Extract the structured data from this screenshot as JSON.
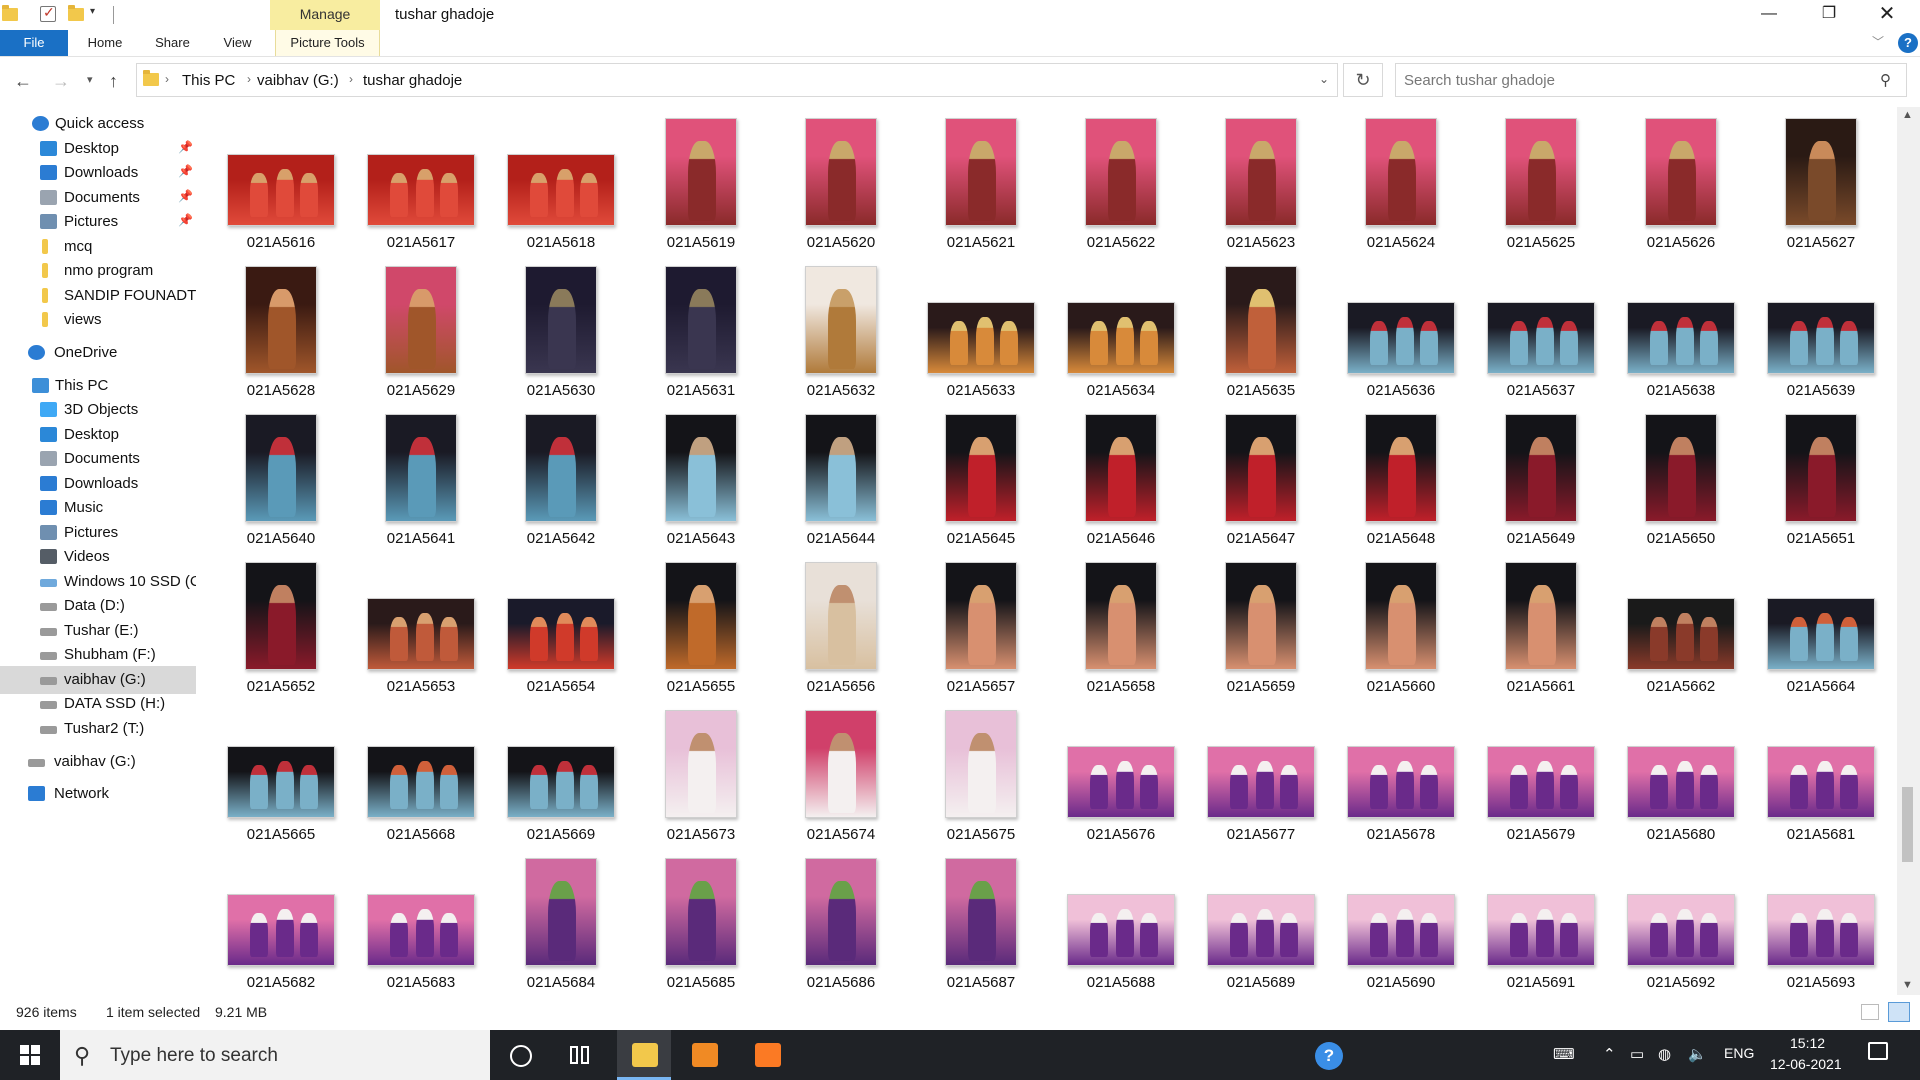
{
  "window": {
    "title": "tushar ghadoje",
    "context_tab": "Manage",
    "minimize_glyph": "—",
    "maximize_glyph": "❐",
    "close_glyph": "✕"
  },
  "ribbon": {
    "tabs": [
      "File",
      "Home",
      "Share",
      "View",
      "Picture Tools"
    ],
    "help_glyph": "?"
  },
  "address": {
    "crumbs": [
      "This PC",
      "vaibhav  (G:)",
      "tushar ghadoje"
    ],
    "search_placeholder": "Search tushar ghadoje"
  },
  "sidebar": {
    "items": [
      {
        "label": "Quick access",
        "icon": "star-icon",
        "color": "#2b7cd3",
        "pinned": false
      },
      {
        "label": "Desktop",
        "icon": "desktop-icon",
        "color": "#2b88d8",
        "pinned": true
      },
      {
        "label": "Downloads",
        "icon": "download-icon",
        "color": "#2b7cd3",
        "pinned": true
      },
      {
        "label": "Documents",
        "icon": "documents-icon",
        "color": "#9aa4b0",
        "pinned": true
      },
      {
        "label": "Pictures",
        "icon": "pictures-icon",
        "color": "#6f8fb0",
        "pinned": true
      },
      {
        "label": "mcq",
        "icon": "folder-icon",
        "color": "#f2c84b",
        "pinned": false
      },
      {
        "label": "nmo program",
        "icon": "folder-icon",
        "color": "#f2c84b",
        "pinned": false
      },
      {
        "label": "SANDIP FOUNADTI(",
        "icon": "folder-icon",
        "color": "#f2c84b",
        "pinned": false
      },
      {
        "label": "views",
        "icon": "folder-icon",
        "color": "#f2c84b",
        "pinned": false
      },
      {
        "label": "OneDrive",
        "icon": "cloud-icon",
        "color": "#2b7cd3",
        "pinned": false
      },
      {
        "label": "This PC",
        "icon": "computer-icon",
        "color": "#3d8fd8",
        "pinned": false
      },
      {
        "label": "3D Objects",
        "icon": "cube-icon",
        "color": "#3fa9f5",
        "pinned": false
      },
      {
        "label": "Desktop",
        "icon": "desktop-icon",
        "color": "#2b88d8",
        "pinned": false
      },
      {
        "label": "Documents",
        "icon": "documents-icon",
        "color": "#9aa4b0",
        "pinned": false
      },
      {
        "label": "Downloads",
        "icon": "download-icon",
        "color": "#2b7cd3",
        "pinned": false
      },
      {
        "label": "Music",
        "icon": "music-icon",
        "color": "#2b7cd3",
        "pinned": false
      },
      {
        "label": "Pictures",
        "icon": "pictures-icon",
        "color": "#6f8fb0",
        "pinned": false
      },
      {
        "label": "Videos",
        "icon": "videos-icon",
        "color": "#555d66",
        "pinned": false
      },
      {
        "label": "Windows 10 SSD (C",
        "icon": "drive-icon",
        "color": "#6fa9dc",
        "pinned": false
      },
      {
        "label": "Data (D:)",
        "icon": "drive-icon",
        "color": "#9a9a9a",
        "pinned": false
      },
      {
        "label": "Tushar (E:)",
        "icon": "drive-icon",
        "color": "#9a9a9a",
        "pinned": false
      },
      {
        "label": "Shubham (F:)",
        "icon": "drive-icon",
        "color": "#9a9a9a",
        "pinned": false
      },
      {
        "label": "vaibhav  (G:)",
        "icon": "drive-icon",
        "color": "#9a9a9a",
        "pinned": false
      },
      {
        "label": "DATA SSD (H:)",
        "icon": "drive-icon",
        "color": "#9a9a9a",
        "pinned": false
      },
      {
        "label": "Tushar2 (T:)",
        "icon": "drive-icon",
        "color": "#9a9a9a",
        "pinned": false
      },
      {
        "label": "vaibhav  (G:)",
        "icon": "drive-icon",
        "color": "#9a9a9a",
        "pinned": false
      },
      {
        "label": "Network",
        "icon": "network-icon",
        "color": "#2b7cd3",
        "pinned": false
      }
    ],
    "selected_label": "vaibhav  (G:)"
  },
  "files": [
    {
      "name": "021A5616",
      "orient": "landscape",
      "colors": [
        "#b3201a",
        "#e04a3a",
        "#d8a06a"
      ]
    },
    {
      "name": "021A5617",
      "orient": "landscape",
      "colors": [
        "#b3201a",
        "#e04a3a",
        "#d8a06a"
      ]
    },
    {
      "name": "021A5618",
      "orient": "landscape",
      "colors": [
        "#b3201a",
        "#e04a3a",
        "#d8a06a"
      ]
    },
    {
      "name": "021A5619",
      "orient": "portrait",
      "colors": [
        "#e0527a",
        "#8a2a2a",
        "#c9a86a"
      ]
    },
    {
      "name": "021A5620",
      "orient": "portrait",
      "colors": [
        "#e0527a",
        "#8a2a2a",
        "#c9a86a"
      ]
    },
    {
      "name": "021A5621",
      "orient": "portrait",
      "colors": [
        "#e0527a",
        "#8a2a2a",
        "#c9a86a"
      ]
    },
    {
      "name": "021A5622",
      "orient": "portrait",
      "colors": [
        "#e0527a",
        "#8a2a2a",
        "#c9a86a"
      ]
    },
    {
      "name": "021A5623",
      "orient": "portrait",
      "colors": [
        "#e0527a",
        "#8a2a2a",
        "#c9a86a"
      ]
    },
    {
      "name": "021A5624",
      "orient": "portrait",
      "colors": [
        "#e0527a",
        "#8a2a2a",
        "#c9a86a"
      ]
    },
    {
      "name": "021A5625",
      "orient": "portrait",
      "colors": [
        "#e0527a",
        "#8a2a2a",
        "#c9a86a"
      ]
    },
    {
      "name": "021A5626",
      "orient": "portrait",
      "colors": [
        "#e0527a",
        "#8a2a2a",
        "#c9a86a"
      ]
    },
    {
      "name": "021A5627",
      "orient": "portrait",
      "colors": [
        "#2a1a14",
        "#7a4a2a",
        "#c98a5a"
      ]
    },
    {
      "name": "021A5628",
      "orient": "portrait",
      "colors": [
        "#3a1a12",
        "#a0562a",
        "#d89a6a"
      ]
    },
    {
      "name": "021A5629",
      "orient": "portrait",
      "colors": [
        "#d0486a",
        "#a0562a",
        "#d89a6a"
      ]
    },
    {
      "name": "021A5630",
      "orient": "portrait",
      "colors": [
        "#1e1a30",
        "#3a3650",
        "#8a7a5a"
      ]
    },
    {
      "name": "021A5631",
      "orient": "portrait",
      "colors": [
        "#1e1a30",
        "#3a3650",
        "#8a7a5a"
      ]
    },
    {
      "name": "021A5632",
      "orient": "portrait",
      "colors": [
        "#f0e8e0",
        "#b07a3a",
        "#c9a06a"
      ]
    },
    {
      "name": "021A5633",
      "orient": "landscape",
      "colors": [
        "#2a1a1a",
        "#d88a3a",
        "#e0c070"
      ]
    },
    {
      "name": "021A5634",
      "orient": "landscape",
      "colors": [
        "#2a1a1a",
        "#d88a3a",
        "#e0c070"
      ]
    },
    {
      "name": "021A5635",
      "orient": "portrait",
      "colors": [
        "#2a1a1a",
        "#c0603a",
        "#e0c070"
      ]
    },
    {
      "name": "021A5636",
      "orient": "landscape",
      "colors": [
        "#1a1a24",
        "#7ab0c8",
        "#c0303a"
      ]
    },
    {
      "name": "021A5637",
      "orient": "landscape",
      "colors": [
        "#1a1a24",
        "#7ab0c8",
        "#c0303a"
      ]
    },
    {
      "name": "021A5638",
      "orient": "landscape",
      "colors": [
        "#1a1a24",
        "#7ab0c8",
        "#c0303a"
      ]
    },
    {
      "name": "021A5639",
      "orient": "landscape",
      "colors": [
        "#1a1a24",
        "#7ab0c8",
        "#c0303a"
      ]
    },
    {
      "name": "021A5640",
      "orient": "portrait",
      "colors": [
        "#1a1a24",
        "#5a9ab8",
        "#c0303a"
      ]
    },
    {
      "name": "021A5641",
      "orient": "portrait",
      "colors": [
        "#1a1a24",
        "#5a9ab8",
        "#c0303a"
      ]
    },
    {
      "name": "021A5642",
      "orient": "portrait",
      "colors": [
        "#1a1a24",
        "#5a9ab8",
        "#c0303a"
      ]
    },
    {
      "name": "021A5643",
      "orient": "portrait",
      "colors": [
        "#141418",
        "#8ac0d8",
        "#c0a080"
      ]
    },
    {
      "name": "021A5644",
      "orient": "portrait",
      "colors": [
        "#141418",
        "#8ac0d8",
        "#c0a080"
      ]
    },
    {
      "name": "021A5645",
      "orient": "portrait",
      "colors": [
        "#141418",
        "#c0202a",
        "#d8a070"
      ]
    },
    {
      "name": "021A5646",
      "orient": "portrait",
      "colors": [
        "#141418",
        "#c0202a",
        "#d8a070"
      ]
    },
    {
      "name": "021A5647",
      "orient": "portrait",
      "colors": [
        "#141418",
        "#c0202a",
        "#d8a070"
      ]
    },
    {
      "name": "021A5648",
      "orient": "portrait",
      "colors": [
        "#141418",
        "#c0202a",
        "#d8a070"
      ]
    },
    {
      "name": "021A5649",
      "orient": "portrait",
      "colors": [
        "#141418",
        "#8a1a2a",
        "#c08060"
      ]
    },
    {
      "name": "021A5650",
      "orient": "portrait",
      "colors": [
        "#141418",
        "#8a1a2a",
        "#c08060"
      ]
    },
    {
      "name": "021A5651",
      "orient": "portrait",
      "colors": [
        "#141418",
        "#8a1a2a",
        "#c08060"
      ]
    },
    {
      "name": "021A5652",
      "orient": "portrait",
      "colors": [
        "#141418",
        "#8a1a2a",
        "#c08060"
      ]
    },
    {
      "name": "021A5653",
      "orient": "landscape",
      "colors": [
        "#2a1a1a",
        "#c05a3a",
        "#d8a070"
      ]
    },
    {
      "name": "021A5654",
      "orient": "landscape",
      "colors": [
        "#1a1a2a",
        "#d03a2a",
        "#e08a5a"
      ]
    },
    {
      "name": "021A5655",
      "orient": "portrait",
      "colors": [
        "#141418",
        "#c06a2a",
        "#d8a070"
      ]
    },
    {
      "name": "021A5656",
      "orient": "portrait",
      "colors": [
        "#e8e0d8",
        "#d8c0a0",
        "#c09070"
      ]
    },
    {
      "name": "021A5657",
      "orient": "portrait",
      "colors": [
        "#141418",
        "#d89070",
        "#d8a070"
      ]
    },
    {
      "name": "021A5658",
      "orient": "portrait",
      "colors": [
        "#141418",
        "#d89070",
        "#d8a070"
      ]
    },
    {
      "name": "021A5659",
      "orient": "portrait",
      "colors": [
        "#141418",
        "#d89070",
        "#d8a070"
      ]
    },
    {
      "name": "021A5660",
      "orient": "portrait",
      "colors": [
        "#141418",
        "#d89070",
        "#d8a070"
      ]
    },
    {
      "name": "021A5661",
      "orient": "portrait",
      "colors": [
        "#141418",
        "#d89070",
        "#d8a070"
      ]
    },
    {
      "name": "021A5662",
      "orient": "landscape",
      "colors": [
        "#1a1a1a",
        "#8a3a2a",
        "#c08060"
      ]
    },
    {
      "name": "021A5664",
      "orient": "landscape",
      "colors": [
        "#1a1a24",
        "#7ab0c8",
        "#d0603a"
      ]
    },
    {
      "name": "021A5665",
      "orient": "landscape",
      "colors": [
        "#141418",
        "#7ab0c8",
        "#c0303a"
      ]
    },
    {
      "name": "021A5668",
      "orient": "landscape",
      "colors": [
        "#141418",
        "#7ab0c8",
        "#d0603a"
      ]
    },
    {
      "name": "021A5669",
      "orient": "landscape",
      "colors": [
        "#141418",
        "#7ab0c8",
        "#c0303a"
      ]
    },
    {
      "name": "021A5673",
      "orient": "portrait",
      "colors": [
        "#e8c0d8",
        "#f4f0f0",
        "#c09070"
      ]
    },
    {
      "name": "021A5674",
      "orient": "portrait",
      "colors": [
        "#d0406a",
        "#f4f0f0",
        "#c09070"
      ]
    },
    {
      "name": "021A5675",
      "orient": "portrait",
      "colors": [
        "#e8c0d8",
        "#f4f0f0",
        "#c09070"
      ]
    },
    {
      "name": "021A5676",
      "orient": "landscape",
      "colors": [
        "#e070a8",
        "#6a2a8a",
        "#f4f0f0"
      ]
    },
    {
      "name": "021A5677",
      "orient": "landscape",
      "colors": [
        "#e070a8",
        "#6a2a8a",
        "#f4f0f0"
      ]
    },
    {
      "name": "021A5678",
      "orient": "landscape",
      "colors": [
        "#e070a8",
        "#6a2a8a",
        "#f4f0f0"
      ]
    },
    {
      "name": "021A5679",
      "orient": "landscape",
      "colors": [
        "#e070a8",
        "#6a2a8a",
        "#f4f0f0"
      ]
    },
    {
      "name": "021A5680",
      "orient": "landscape",
      "colors": [
        "#e070a8",
        "#6a2a8a",
        "#f4f0f0"
      ]
    },
    {
      "name": "021A5681",
      "orient": "landscape",
      "colors": [
        "#e070a8",
        "#6a2a8a",
        "#f4f0f0"
      ]
    },
    {
      "name": "021A5682",
      "orient": "landscape",
      "colors": [
        "#e070a8",
        "#6a2a8a",
        "#f4f0f0"
      ]
    },
    {
      "name": "021A5683",
      "orient": "landscape",
      "colors": [
        "#e070a8",
        "#6a2a8a",
        "#f4f0f0"
      ]
    },
    {
      "name": "021A5684",
      "orient": "portrait",
      "colors": [
        "#d06aa0",
        "#5a2a7a",
        "#6aa04a"
      ]
    },
    {
      "name": "021A5685",
      "orient": "portrait",
      "colors": [
        "#d06aa0",
        "#5a2a7a",
        "#6aa04a"
      ]
    },
    {
      "name": "021A5686",
      "orient": "portrait",
      "colors": [
        "#d06aa0",
        "#5a2a7a",
        "#6aa04a"
      ]
    },
    {
      "name": "021A5687",
      "orient": "portrait",
      "colors": [
        "#d06aa0",
        "#5a2a7a",
        "#6aa04a"
      ]
    },
    {
      "name": "021A5688",
      "orient": "landscape",
      "colors": [
        "#f0c0d8",
        "#6a2a8a",
        "#f4f0f0"
      ]
    },
    {
      "name": "021A5689",
      "orient": "landscape",
      "colors": [
        "#f0c0d8",
        "#6a2a8a",
        "#f4f0f0"
      ]
    },
    {
      "name": "021A5690",
      "orient": "landscape",
      "colors": [
        "#f0c0d8",
        "#6a2a8a",
        "#f4f0f0"
      ]
    },
    {
      "name": "021A5691",
      "orient": "landscape",
      "colors": [
        "#f0c0d8",
        "#6a2a8a",
        "#f4f0f0"
      ]
    },
    {
      "name": "021A5692",
      "orient": "landscape",
      "colors": [
        "#f0c0d8",
        "#6a2a8a",
        "#f4f0f0"
      ]
    },
    {
      "name": "021A5693",
      "orient": "landscape",
      "colors": [
        "#f0c0d8",
        "#6a2a8a",
        "#f4f0f0"
      ]
    }
  ],
  "status": {
    "count": "926 items",
    "selected": "1 item selected",
    "size": "9.21 MB"
  },
  "taskbar": {
    "search_placeholder": "Type here to search",
    "language": "ENG",
    "time": "15:12",
    "date": "12-06-2021",
    "help_glyph": "?"
  },
  "colors": {
    "accent": "#1a70c5",
    "manage_tab": "#f8eda0",
    "taskbar": "#1f2226"
  }
}
